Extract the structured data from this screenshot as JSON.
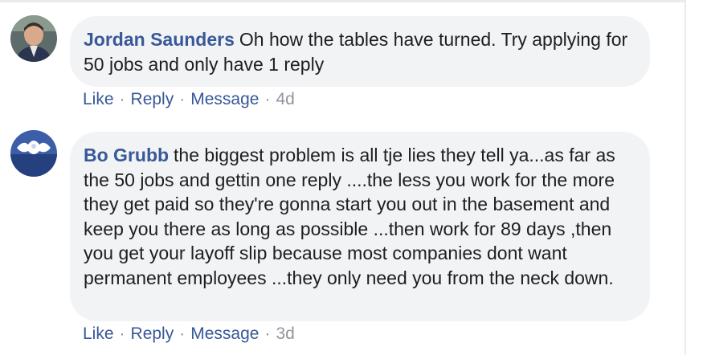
{
  "comments": [
    {
      "author": "Jordan Saunders",
      "text": "Oh how the tables have turned. Try applying for 50 jobs and only have 1 reply",
      "actions": {
        "like": "Like",
        "reply": "Reply",
        "message": "Message",
        "time": "4d"
      },
      "separator": "·"
    },
    {
      "author": "Bo Grubb",
      "text": "the biggest problem is all tje lies they tell ya...as far as the 50 jobs and gettin one reply ....the less you work for the more they get paid so they're gonna start you out in the basement and keep you there as long as possible ...then work for 89 days ,then you get your layoff slip because most companies dont want permanent employees ...they only need you from the neck down.",
      "actions": {
        "like": "Like",
        "reply": "Reply",
        "message": "Message",
        "time": "3d"
      },
      "separator": "·"
    }
  ]
}
